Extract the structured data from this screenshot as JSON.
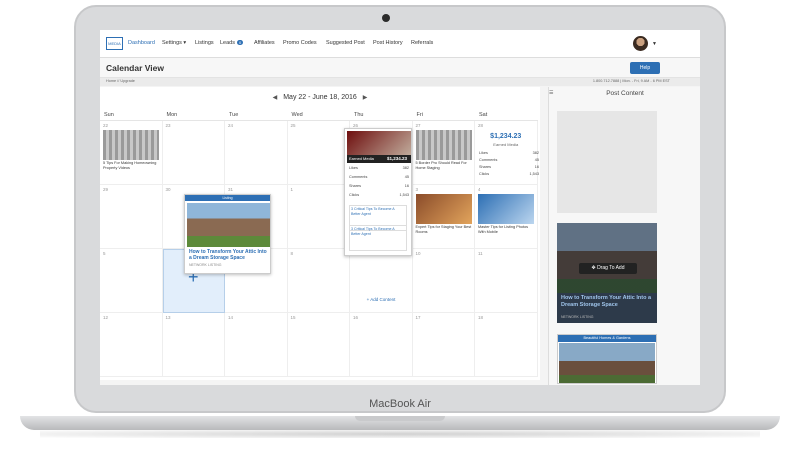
{
  "device": {
    "brand_label": "MacBook Air"
  },
  "nav": {
    "logo_text": "MEDIA",
    "items": [
      {
        "label": "Dashboard",
        "active": true
      },
      {
        "label": "Settings ▾",
        "active": false
      },
      {
        "label": "Listings",
        "active": false
      },
      {
        "label": "Leads",
        "badge": "0",
        "active": false
      },
      {
        "label": "Affiliates",
        "active": false
      },
      {
        "label": "Promo Codes",
        "active": false
      },
      {
        "label": "Suggested Post",
        "active": false
      },
      {
        "label": "Post History",
        "active": false
      },
      {
        "label": "Referrals",
        "active": false
      }
    ]
  },
  "page": {
    "title": "Calendar View",
    "help_label": "Help",
    "breadcrumb": "Home // Upgrade",
    "contact": "1.800.712.7888 | Mon. - Fri, 9 AM - 6 PM EST"
  },
  "calendar": {
    "range_label": "May 22 - June 18, 2016",
    "prev_icon": "◀",
    "next_icon": "▶",
    "days": [
      "Sun",
      "Mon",
      "Tue",
      "Wed",
      "Thu",
      "Fri",
      "Sat"
    ],
    "weeks": [
      [
        "22",
        "23",
        "24",
        "25",
        "26",
        "27",
        "28"
      ],
      [
        "29",
        "30",
        "31",
        "1",
        "2",
        "3",
        "4"
      ],
      [
        "5",
        "6",
        "7",
        "8",
        "9",
        "10",
        "11"
      ],
      [
        "12",
        "13",
        "14",
        "15",
        "16",
        "17",
        "18"
      ]
    ],
    "add_content_label": "+ Add Content",
    "posts": {
      "sun_w1_caption": "5 Tips For Making Homeowning Property Videos",
      "fri_w1_caption": "5 Border Pro Should Read For Home Staging",
      "fri_w2_caption": "Expert Tips for Staging Your Best Rooms",
      "sat_w2_caption": "Master Tips for Listing Photos With Mobile"
    },
    "listing_card": {
      "tag": "Listing",
      "title": "How to Transform Your Attic Into a Dream Storage Space",
      "source": "NETWORK LISTING"
    },
    "stat_card": {
      "label": "Earned Media",
      "amount": "$1,234.23",
      "rows": [
        {
          "name": "Likes",
          "value": "382"
        },
        {
          "name": "Comments",
          "value": "45"
        },
        {
          "name": "Shares",
          "value": "16"
        },
        {
          "name": "Clicks",
          "value": "1,543"
        }
      ],
      "mini_title": "3 Critical Tips To Become A Better Agent"
    },
    "sat_stats": {
      "amount": "$1,234.23",
      "label": "Earned Media",
      "rows": [
        {
          "name": "Likes",
          "value": "382"
        },
        {
          "name": "Comments",
          "value": "45"
        },
        {
          "name": "Shares",
          "value": "16"
        },
        {
          "name": "Clicks",
          "value": "1,543"
        }
      ]
    }
  },
  "side": {
    "header": "Post Content",
    "drag_label": "✥ Drag To Add",
    "drag_title": "How to Transform Your Attic Into a Dream Storage Space",
    "drag_source": "NETWORK LISTING",
    "drag_tag": "Beautiful Homes & Gardens",
    "small_card_tag": "Beautiful Homes & Gardens"
  },
  "colors": {
    "accent": "#2d6fb4"
  }
}
